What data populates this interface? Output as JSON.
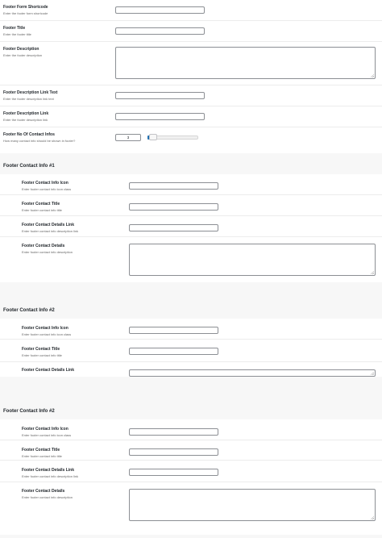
{
  "general_fields": {
    "form_shortcode": {
      "label": "Footer Form Shortcode",
      "description": "Enter the footer form shortcode",
      "value": ""
    },
    "title": {
      "label": "Footer Title",
      "description": "Enter the footer title",
      "value": ""
    },
    "description": {
      "label": "Footer Description",
      "description": "Enter the footer description",
      "value": ""
    },
    "link_text": {
      "label": "Footer Description Link Text",
      "description": "Enter the footer description link text",
      "value": ""
    },
    "link": {
      "label": "Footer Description Link",
      "description": "Enter the footer description link",
      "value": ""
    },
    "contact_count": {
      "label": "Footer No Of Contact Infos",
      "description": "How many contact info should be shown in footer?",
      "value": "3",
      "slider_fraction": 0.05
    }
  },
  "contact_groups": [
    {
      "title": "Footer Contact Info #1",
      "fields": [
        {
          "label": "Footer Contact Info Icon",
          "description": "Enter footer contact info icon class"
        },
        {
          "label": "Footer Contact Title",
          "description": "Enter footer contact info title"
        },
        {
          "label": "Footer Contact Details Link",
          "description": "Enter footer contact info description link"
        },
        {
          "label": "Footer Contact Details",
          "description": "Enter footer contact info description"
        }
      ]
    },
    {
      "title": "Footer Contact Info #2",
      "fields": [
        {
          "label": "Footer Contact Info Icon",
          "description": "Enter footer contact info icon class"
        },
        {
          "label": "Footer Contact Title",
          "description": "Enter footer contact info title"
        },
        {
          "label": "Footer Contact Details Link",
          "description": ""
        }
      ]
    },
    {
      "title": "Footer Contact Info #2",
      "fields": [
        {
          "label": "Footer Contact Info Icon",
          "description": "Enter footer contact info icon class"
        },
        {
          "label": "Footer Contact Title",
          "description": "Enter footer contact info title"
        },
        {
          "label": "Footer Contact Details Link",
          "description": "Enter footer contact info description link"
        },
        {
          "label": "Footer Contact Details",
          "description": "Enter footer contact info description"
        }
      ]
    }
  ],
  "colors": {
    "accent": "#2271b1",
    "border": "#8c8f94",
    "background": "#f7f7f7"
  }
}
